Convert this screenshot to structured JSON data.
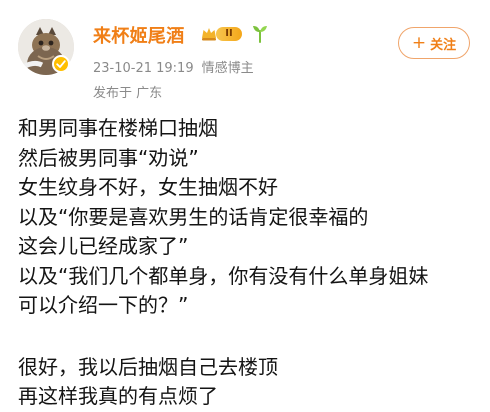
{
  "header": {
    "username": "来杯姬尾酒",
    "level_badge": "II",
    "post_time": "23-10-21 19:19",
    "category": "情感博主",
    "location": "发布于 广东",
    "follow_label": "关注",
    "follow_icon": "plus-icon"
  },
  "post": {
    "lines": [
      "和男同事在楼梯口抽烟",
      "然后被男同事“劝说”",
      "女生纹身不好，女生抽烟不好",
      "以及“你要是喜欢男生的话肯定很幸福的",
      "这会儿已经成家了”",
      "以及“我们几个都单身，你有没有什么单身姐妹",
      "可以介绍一下的？”",
      "很好，我以后抽烟自己去楼顶",
      "再这样我真的有点烦了"
    ]
  },
  "colors": {
    "accent": "#f07f17",
    "meta": "#8a8a8a",
    "badge": "#ffbf00",
    "plant": "#7cc23d",
    "text": "#141414"
  }
}
